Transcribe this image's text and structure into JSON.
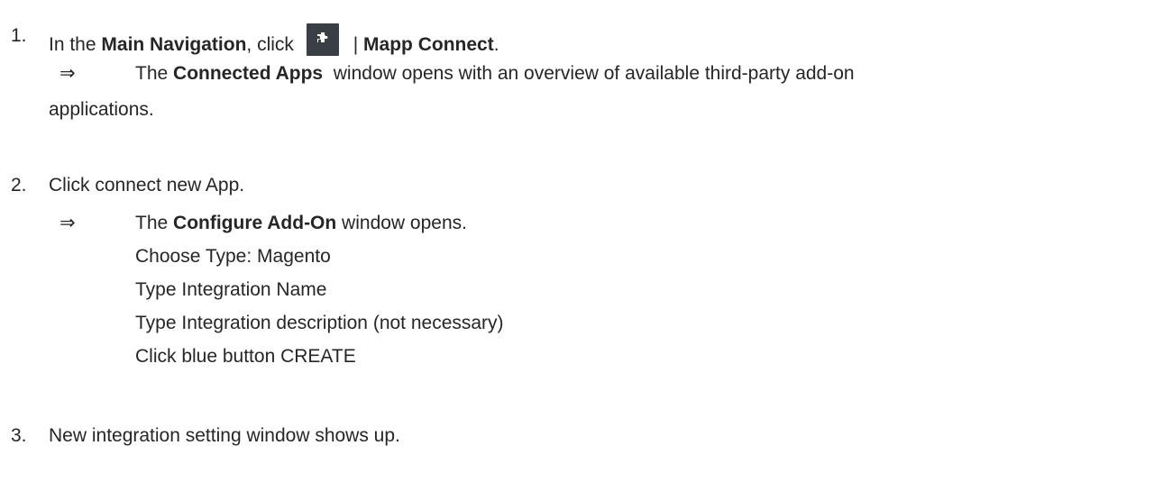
{
  "step1": {
    "number": "1.",
    "prefix": "In the ",
    "main_navigation": "Main Navigation",
    "comma_click": ", click",
    "icon": "puzzle-piece-icon",
    "separator": " | ",
    "mapp_connect": "Mapp Connect",
    "period": ".",
    "result_arrow": "⇒",
    "result_prefix": "The ",
    "connected_apps": "Connected Apps",
    "result_suffix": "  window opens with an overview of available third-party add-on",
    "result_continued": "applications."
  },
  "step2": {
    "number": "2.",
    "text": "Click connect new App.",
    "result_arrow": "⇒",
    "result_prefix": "The ",
    "configure_addon": "Configure Add-On",
    "result_suffix": " window opens.",
    "substeps": [
      "Choose Type: Magento",
      "Type Integration Name",
      "Type Integration description (not necessary)",
      "Click blue button CREATE"
    ]
  },
  "step3": {
    "number": "3.",
    "text": "New integration setting window shows up."
  }
}
